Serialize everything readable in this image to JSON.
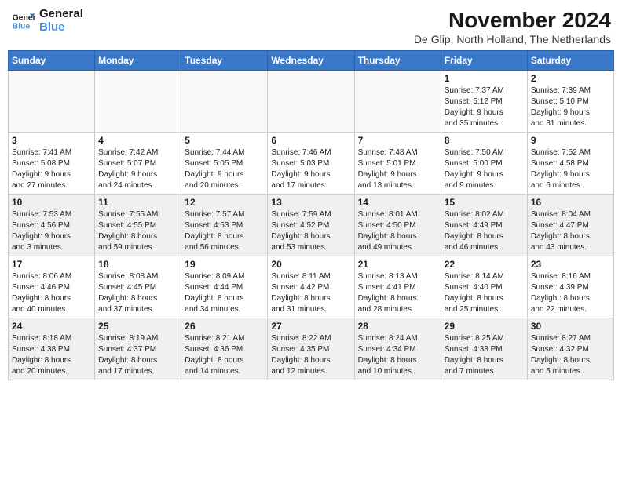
{
  "logo": {
    "line1": "General",
    "line2": "Blue"
  },
  "title": "November 2024",
  "location": "De Glip, North Holland, The Netherlands",
  "weekdays": [
    "Sunday",
    "Monday",
    "Tuesday",
    "Wednesday",
    "Thursday",
    "Friday",
    "Saturday"
  ],
  "weeks": [
    [
      {
        "day": "",
        "content": ""
      },
      {
        "day": "",
        "content": ""
      },
      {
        "day": "",
        "content": ""
      },
      {
        "day": "",
        "content": ""
      },
      {
        "day": "",
        "content": ""
      },
      {
        "day": "1",
        "content": "Sunrise: 7:37 AM\nSunset: 5:12 PM\nDaylight: 9 hours\nand 35 minutes."
      },
      {
        "day": "2",
        "content": "Sunrise: 7:39 AM\nSunset: 5:10 PM\nDaylight: 9 hours\nand 31 minutes."
      }
    ],
    [
      {
        "day": "3",
        "content": "Sunrise: 7:41 AM\nSunset: 5:08 PM\nDaylight: 9 hours\nand 27 minutes."
      },
      {
        "day": "4",
        "content": "Sunrise: 7:42 AM\nSunset: 5:07 PM\nDaylight: 9 hours\nand 24 minutes."
      },
      {
        "day": "5",
        "content": "Sunrise: 7:44 AM\nSunset: 5:05 PM\nDaylight: 9 hours\nand 20 minutes."
      },
      {
        "day": "6",
        "content": "Sunrise: 7:46 AM\nSunset: 5:03 PM\nDaylight: 9 hours\nand 17 minutes."
      },
      {
        "day": "7",
        "content": "Sunrise: 7:48 AM\nSunset: 5:01 PM\nDaylight: 9 hours\nand 13 minutes."
      },
      {
        "day": "8",
        "content": "Sunrise: 7:50 AM\nSunset: 5:00 PM\nDaylight: 9 hours\nand 9 minutes."
      },
      {
        "day": "9",
        "content": "Sunrise: 7:52 AM\nSunset: 4:58 PM\nDaylight: 9 hours\nand 6 minutes."
      }
    ],
    [
      {
        "day": "10",
        "content": "Sunrise: 7:53 AM\nSunset: 4:56 PM\nDaylight: 9 hours\nand 3 minutes."
      },
      {
        "day": "11",
        "content": "Sunrise: 7:55 AM\nSunset: 4:55 PM\nDaylight: 8 hours\nand 59 minutes."
      },
      {
        "day": "12",
        "content": "Sunrise: 7:57 AM\nSunset: 4:53 PM\nDaylight: 8 hours\nand 56 minutes."
      },
      {
        "day": "13",
        "content": "Sunrise: 7:59 AM\nSunset: 4:52 PM\nDaylight: 8 hours\nand 53 minutes."
      },
      {
        "day": "14",
        "content": "Sunrise: 8:01 AM\nSunset: 4:50 PM\nDaylight: 8 hours\nand 49 minutes."
      },
      {
        "day": "15",
        "content": "Sunrise: 8:02 AM\nSunset: 4:49 PM\nDaylight: 8 hours\nand 46 minutes."
      },
      {
        "day": "16",
        "content": "Sunrise: 8:04 AM\nSunset: 4:47 PM\nDaylight: 8 hours\nand 43 minutes."
      }
    ],
    [
      {
        "day": "17",
        "content": "Sunrise: 8:06 AM\nSunset: 4:46 PM\nDaylight: 8 hours\nand 40 minutes."
      },
      {
        "day": "18",
        "content": "Sunrise: 8:08 AM\nSunset: 4:45 PM\nDaylight: 8 hours\nand 37 minutes."
      },
      {
        "day": "19",
        "content": "Sunrise: 8:09 AM\nSunset: 4:44 PM\nDaylight: 8 hours\nand 34 minutes."
      },
      {
        "day": "20",
        "content": "Sunrise: 8:11 AM\nSunset: 4:42 PM\nDaylight: 8 hours\nand 31 minutes."
      },
      {
        "day": "21",
        "content": "Sunrise: 8:13 AM\nSunset: 4:41 PM\nDaylight: 8 hours\nand 28 minutes."
      },
      {
        "day": "22",
        "content": "Sunrise: 8:14 AM\nSunset: 4:40 PM\nDaylight: 8 hours\nand 25 minutes."
      },
      {
        "day": "23",
        "content": "Sunrise: 8:16 AM\nSunset: 4:39 PM\nDaylight: 8 hours\nand 22 minutes."
      }
    ],
    [
      {
        "day": "24",
        "content": "Sunrise: 8:18 AM\nSunset: 4:38 PM\nDaylight: 8 hours\nand 20 minutes."
      },
      {
        "day": "25",
        "content": "Sunrise: 8:19 AM\nSunset: 4:37 PM\nDaylight: 8 hours\nand 17 minutes."
      },
      {
        "day": "26",
        "content": "Sunrise: 8:21 AM\nSunset: 4:36 PM\nDaylight: 8 hours\nand 14 minutes."
      },
      {
        "day": "27",
        "content": "Sunrise: 8:22 AM\nSunset: 4:35 PM\nDaylight: 8 hours\nand 12 minutes."
      },
      {
        "day": "28",
        "content": "Sunrise: 8:24 AM\nSunset: 4:34 PM\nDaylight: 8 hours\nand 10 minutes."
      },
      {
        "day": "29",
        "content": "Sunrise: 8:25 AM\nSunset: 4:33 PM\nDaylight: 8 hours\nand 7 minutes."
      },
      {
        "day": "30",
        "content": "Sunrise: 8:27 AM\nSunset: 4:32 PM\nDaylight: 8 hours\nand 5 minutes."
      }
    ]
  ]
}
